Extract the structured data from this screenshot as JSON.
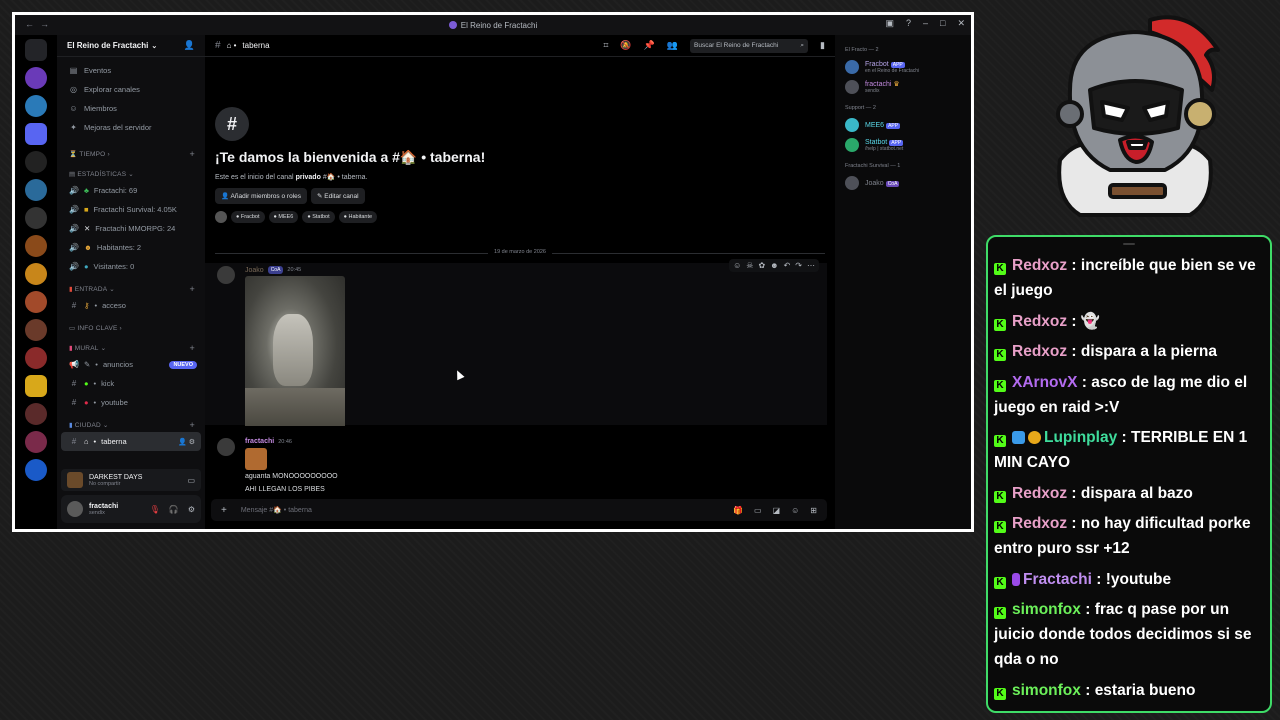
{
  "window": {
    "title": "El Reino de Fractachi"
  },
  "server": {
    "name": "El Reino de Fractachi",
    "nav": [
      {
        "icon": "calendar-icon",
        "label": "Eventos"
      },
      {
        "icon": "compass-icon",
        "label": "Explorar canales"
      },
      {
        "icon": "members-icon",
        "label": "Miembros"
      },
      {
        "icon": "rocket-icon",
        "label": "Mejoras del servidor"
      }
    ],
    "categories": [
      {
        "label": "TIEMPO",
        "channels": []
      },
      {
        "label": "ESTADÍSTICAS",
        "channels": [
          "Fractachi: 69",
          "Fractachi Survival: 4.05K",
          "Fractachi MMORPG: 24",
          "Habitantes: 2",
          "Visitantes: 0"
        ]
      },
      {
        "label": "ENTRADA",
        "channels": [
          "acceso"
        ]
      },
      {
        "label": "INFO CLAVE",
        "channels": []
      },
      {
        "label": "MURAL",
        "channels": [
          "anuncios",
          "kick",
          "youtube"
        ],
        "badge": "NUEVO"
      },
      {
        "label": "CIUDAD",
        "channels": [
          "taberna"
        ]
      }
    ]
  },
  "voice": {
    "title": "DARKEST DAYS",
    "subtitle": "No compartir"
  },
  "user": {
    "name": "fractachi",
    "status": "sendix"
  },
  "channel": {
    "name": "taberna",
    "search_placeholder": "Buscar El Reino de Fractachi",
    "welcome_title": "¡Te damos la bienvenida a #🏠 • taberna!",
    "welcome_prefix": "Este es el inicio del canal",
    "welcome_bold": "privado",
    "welcome_suffix": "#🏠 • taberna.",
    "add_members_label": "Añadir miembros o roles",
    "edit_channel_label": "Editar canal",
    "chips": [
      "Fracbot",
      "MEE6",
      "Statbot",
      "Habitante"
    ],
    "date_divider": "19 de marzo de 2026",
    "composer_placeholder": "Mensaje #🏠 • taberna"
  },
  "messages": [
    {
      "author": "Joako",
      "tag": "CoA",
      "time": "20:45",
      "attachment": "monkey-photo"
    },
    {
      "author": "fractachi",
      "time": "20:46",
      "lines": [
        "aguanta MONOOOOOOOOO",
        "AHI LLEGAN LOS PIBES"
      ]
    }
  ],
  "members": [
    {
      "group": "El Fracto — 2",
      "items": [
        {
          "name": "Fracbot",
          "badge": "APP",
          "sub": "en el Reino de Fractachi"
        },
        {
          "name": "fractachi",
          "sub": "sendix"
        }
      ]
    },
    {
      "group": "Support — 2",
      "items": [
        {
          "name": "MEE6",
          "badge": "APP",
          "sub": ""
        },
        {
          "name": "Statbot",
          "badge": "APP",
          "sub": "/help | statbot.net"
        }
      ]
    },
    {
      "group": "Fractachi Survival — 1",
      "items": [
        {
          "name": "Joako",
          "badge": "CoA",
          "sub": ""
        }
      ]
    }
  ],
  "chat": {
    "accent": "#3fdc68",
    "messages": [
      {
        "user": "Redxoz",
        "color": "#e8a0c8",
        "text": "increíble que bien se ve el juego"
      },
      {
        "user": "Redxoz",
        "color": "#e8a0c8",
        "text": "👻"
      },
      {
        "user": "Redxoz",
        "color": "#e8a0c8",
        "text": "dispara a la pierna"
      },
      {
        "user": "XArnovX",
        "color": "#b36bf0",
        "text": "asco de lag me dio el juego en raid >:V"
      },
      {
        "user": "Lupinplay",
        "color": "#3fdc9c",
        "text": "TERRIBLE EN 1 MIN CAYO"
      },
      {
        "user": "Redxoz",
        "color": "#e8a0c8",
        "text": "dispara al bazo"
      },
      {
        "user": "Redxoz",
        "color": "#e8a0c8",
        "text": "no hay dificultad porke entro puro ssr +12"
      },
      {
        "user": "Fractachi",
        "color": "#c08ef0",
        "text": "!youtube"
      },
      {
        "user": "simonfox",
        "color": "#6cf05a",
        "text": "frac q pase por un juicio donde todos decidimos si se qda o no"
      },
      {
        "user": "simonfox",
        "color": "#6cf05a",
        "text": "estaria bueno"
      }
    ]
  }
}
